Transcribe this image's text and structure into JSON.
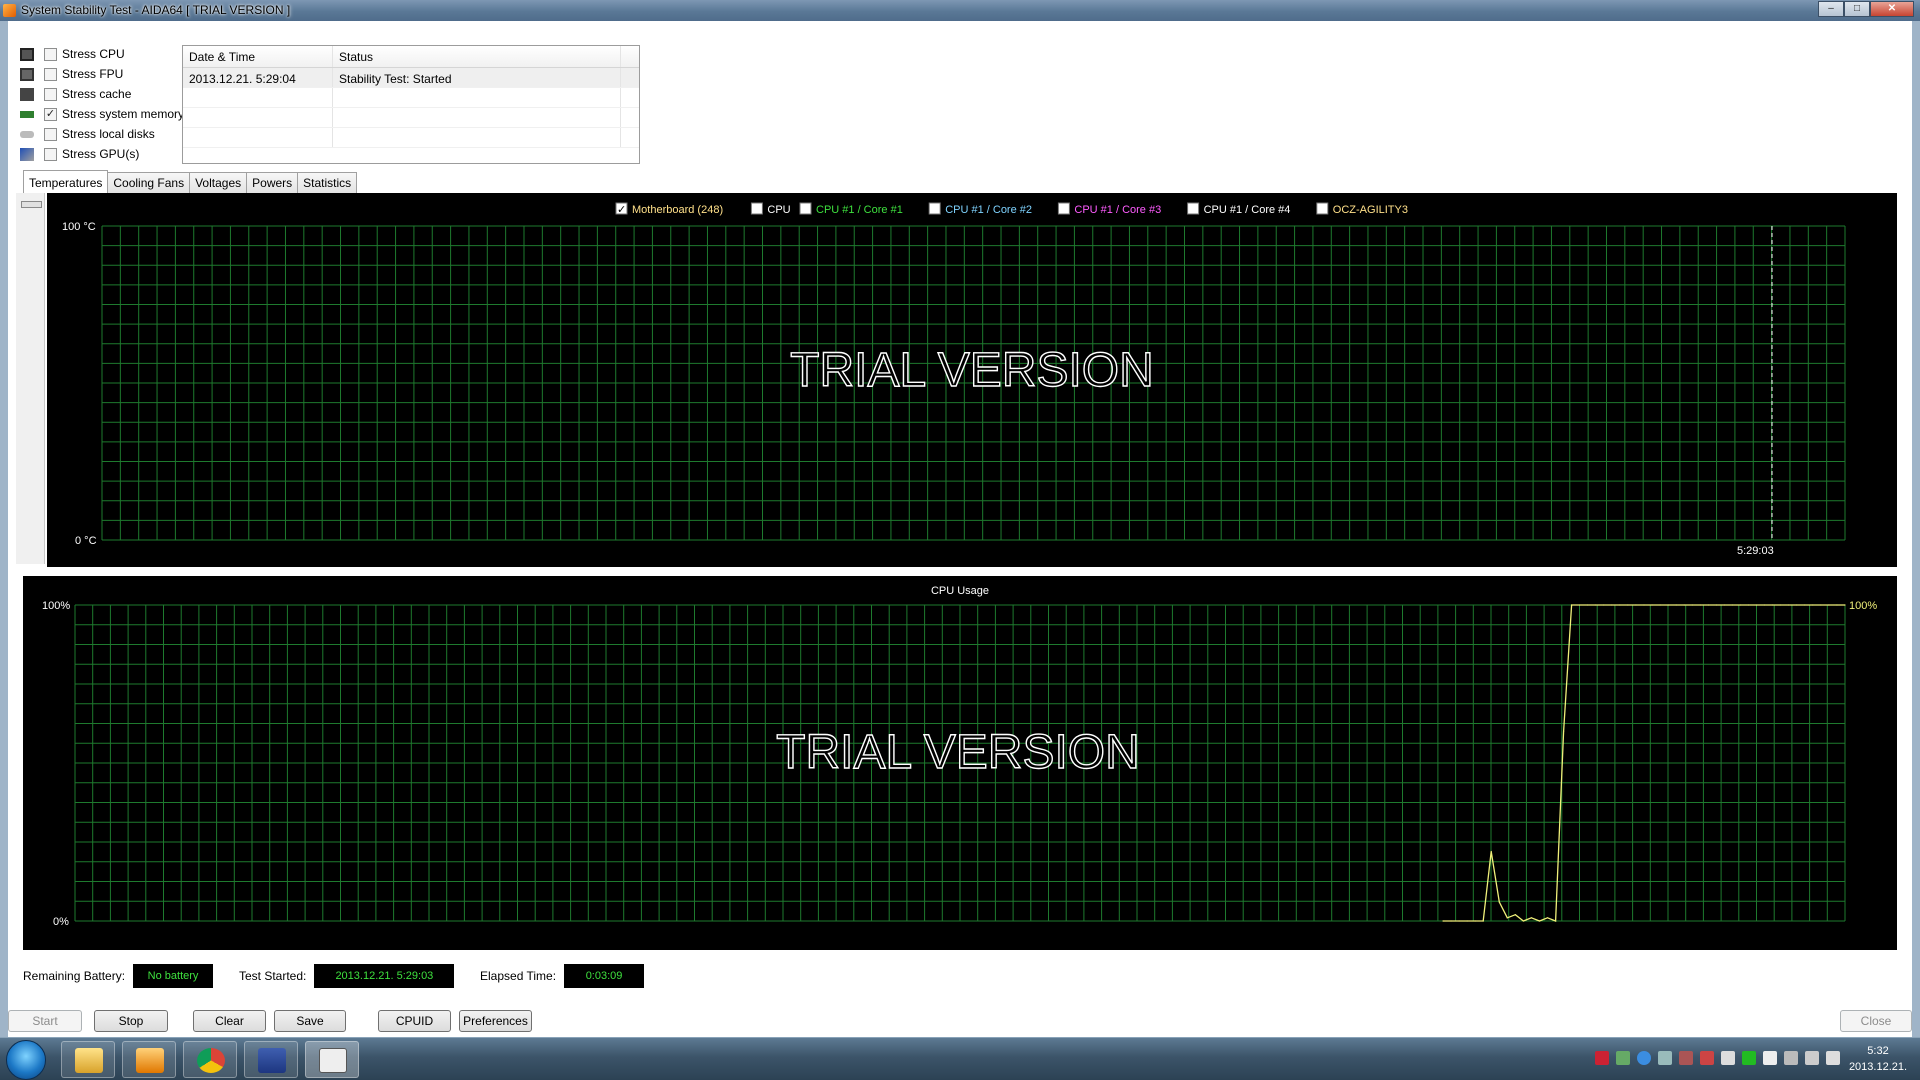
{
  "window": {
    "title": "System Stability Test - AIDA64  [ TRIAL VERSION ]",
    "controls": {
      "minimize": "–",
      "maximize": "□",
      "close": "✕"
    }
  },
  "stress_options": [
    {
      "label": "Stress CPU",
      "checked": false,
      "icon": "cpu-icon"
    },
    {
      "label": "Stress FPU",
      "checked": false,
      "icon": "fpu-icon"
    },
    {
      "label": "Stress cache",
      "checked": false,
      "icon": "cache-icon"
    },
    {
      "label": "Stress system memory",
      "checked": true,
      "icon": "memory-icon"
    },
    {
      "label": "Stress local disks",
      "checked": false,
      "icon": "disk-icon"
    },
    {
      "label": "Stress GPU(s)",
      "checked": false,
      "icon": "gpu-icon"
    }
  ],
  "log": {
    "columns": [
      "Date & Time",
      "Status"
    ],
    "rows": [
      {
        "datetime": "2013.12.21. 5:29:04",
        "status": "Stability Test: Started"
      }
    ]
  },
  "tabs": [
    "Temperatures",
    "Cooling Fans",
    "Voltages",
    "Powers",
    "Statistics"
  ],
  "active_tab": "Temperatures",
  "temperature_graph": {
    "legend": [
      {
        "label": "Motherboard (248)",
        "checked": true,
        "color": "#ffe08a"
      },
      {
        "label": "CPU",
        "checked": false,
        "color": "#ffffff"
      },
      {
        "label": "CPU #1 / Core #1",
        "checked": false,
        "color": "#3ee03e"
      },
      {
        "label": "CPU #1 / Core #2",
        "checked": false,
        "color": "#7fd3ff"
      },
      {
        "label": "CPU #1 / Core #3",
        "checked": false,
        "color": "#ff5cff"
      },
      {
        "label": "CPU #1 / Core #4",
        "checked": false,
        "color": "#ffffff"
      },
      {
        "label": "OCZ-AGILITY3",
        "checked": false,
        "color": "#ffe08a"
      }
    ],
    "y_max_label": "100 °C",
    "y_min_label": "0 °C",
    "time_label": "5:29:03",
    "watermark": "TRIAL VERSION"
  },
  "cpu_graph": {
    "title": "CPU Usage",
    "y_max_label": "100%",
    "y_min_label": "0%",
    "current_label": "100%",
    "watermark": "TRIAL VERSION",
    "line_color": "#f0f07a"
  },
  "chart_data": {
    "type": "line",
    "title": "CPU Usage",
    "ylabel": "",
    "ylim": [
      0,
      100
    ],
    "series": [
      {
        "values": [
          0,
          0,
          0,
          0,
          0,
          0,
          22,
          6,
          1,
          2,
          0,
          1,
          0,
          1,
          0,
          60,
          100,
          100,
          100,
          100,
          100,
          100,
          100,
          100,
          100,
          100,
          100,
          100,
          100,
          100,
          100,
          100,
          100,
          100,
          100,
          100,
          100,
          100,
          100,
          100,
          100,
          100,
          100,
          100,
          100,
          100,
          100,
          100,
          100,
          100,
          100
        ]
      }
    ]
  },
  "status": {
    "battery_label": "Remaining Battery:",
    "battery_value": "No battery",
    "started_label": "Test Started:",
    "started_value": "2013.12.21. 5:29:03",
    "elapsed_label": "Elapsed Time:",
    "elapsed_value": "0:03:09"
  },
  "buttons": {
    "start": "Start",
    "stop": "Stop",
    "clear": "Clear",
    "save": "Save",
    "cpuid": "CPUID",
    "preferences": "Preferences",
    "close": "Close"
  },
  "taskbar": {
    "apps": [
      "explorer-icon",
      "media-player-icon",
      "chrome-icon",
      "floppy-save-icon",
      "aida64-icon"
    ],
    "clock_time": "5:32",
    "clock_date": "2013.12.21."
  }
}
